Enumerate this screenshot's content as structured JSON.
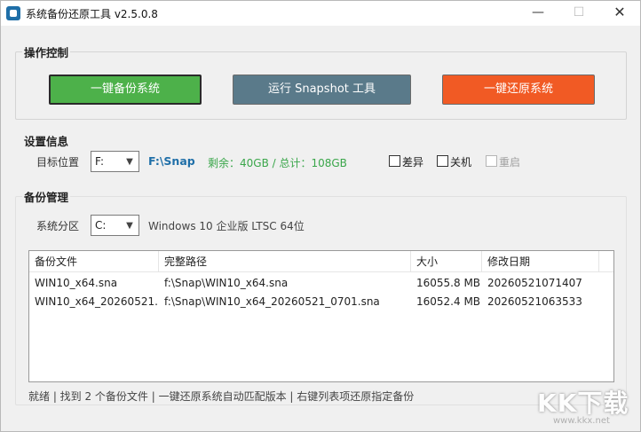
{
  "window": {
    "title": "系统备份还原工具 v2.5.0.8",
    "min_glyph": "—",
    "max_glyph": "☐",
    "close_glyph": "✕"
  },
  "operation": {
    "title": "操作控制",
    "backup_label": "一键备份系统",
    "snapshot_label": "运行 Snapshot 工具",
    "restore_label": "一键还原系统"
  },
  "settings": {
    "title": "设置信息",
    "target_label": "目标位置",
    "target_drive": "F:",
    "target_path": "F:\\Snap",
    "space_text": "剩余：40GB / 总计：108GB",
    "opt_diff": "差异",
    "opt_shutdown": "关机",
    "opt_restart": "重启"
  },
  "backup": {
    "title": "备份管理",
    "partition_label": "系统分区",
    "partition_drive": "C:",
    "os_text": "Windows 10 企业版 LTSC 64位",
    "columns": [
      "备份文件",
      "完整路径",
      "大小",
      "修改日期"
    ],
    "rows": [
      [
        "WIN10_x64.sna",
        "f:\\Snap\\WIN10_x64.sna",
        "16055.8 MB",
        "20260521071407"
      ],
      [
        "WIN10_x64_20260521...",
        "f:\\Snap\\WIN10_x64_20260521_0701.sna",
        "16052.4 MB",
        "20260521063533"
      ]
    ]
  },
  "status_text": "就绪 | 找到 2 个备份文件 | 一键还原系统自动匹配版本 | 右键列表项还原指定备份",
  "watermark": {
    "main": "KK下载",
    "sub": "www.kkx.net"
  },
  "icons": {
    "dropdown": "chevron-down-icon",
    "app": "app-icon"
  },
  "colors": {
    "backup_btn": "#4db14a",
    "snapshot_btn": "#5a7a8a",
    "restore_btn": "#f15a24",
    "path_text": "#1f6fa8",
    "space_text": "#3aa64a"
  }
}
